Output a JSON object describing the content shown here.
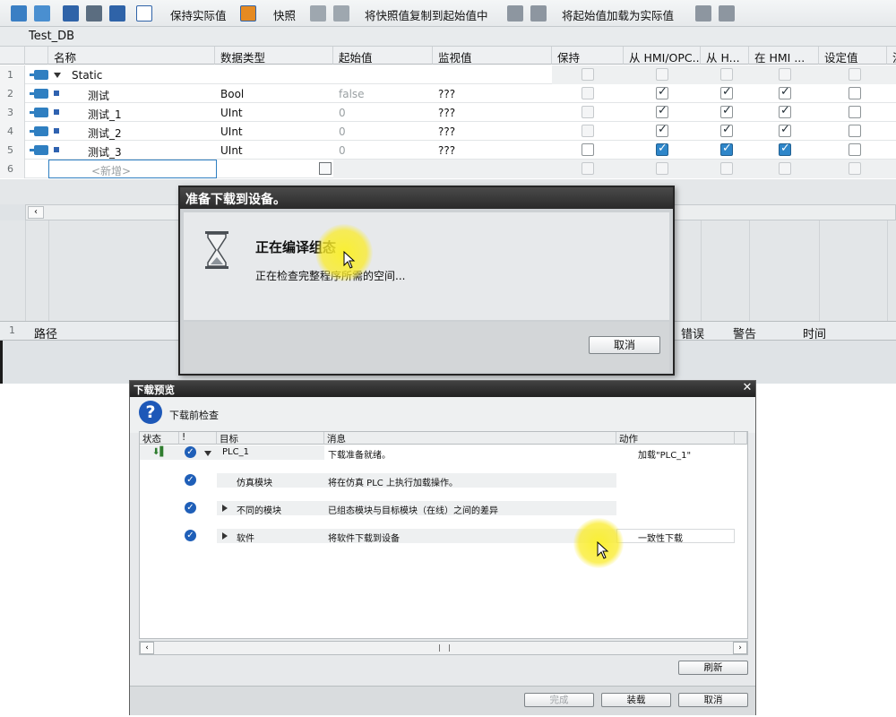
{
  "toolbar": {
    "keep_actual": "保持实际值",
    "snapshot": "快照",
    "copy_snapshot": "将快照值复制到起始值中",
    "load_start": "将起始值加载为实际值"
  },
  "db": {
    "title": "Test_DB"
  },
  "grid": {
    "headers": [
      "名称",
      "数据类型",
      "起始值",
      "监视值",
      "保持",
      "从 HMI/OPC...",
      "从 H...",
      "在 HMI ...",
      "设定值",
      "注"
    ],
    "rows": [
      {
        "num": "1",
        "name": "Static",
        "type": "",
        "start": "",
        "monitor": ""
      },
      {
        "num": "2",
        "name": "测试",
        "type": "Bool",
        "start": "false",
        "monitor": "???"
      },
      {
        "num": "3",
        "name": "测试_1",
        "type": "UInt",
        "start": "0",
        "monitor": "???"
      },
      {
        "num": "4",
        "name": "测试_2",
        "type": "UInt",
        "start": "0",
        "monitor": "???"
      },
      {
        "num": "5",
        "name": "测试_3",
        "type": "UInt",
        "start": "0",
        "monitor": "???"
      },
      {
        "num": "6",
        "name": "<新增>",
        "type": "",
        "start": "",
        "monitor": ""
      }
    ]
  },
  "info_bar": {
    "path": "路径",
    "error": "错误",
    "warning": "警告",
    "time": "时间",
    "row_num": "1"
  },
  "compile_dialog": {
    "title": "准备下载到设备。",
    "heading": "正在编译组态",
    "message": "正在检查完整程序所需的空间...",
    "cancel": "取消"
  },
  "download_dialog": {
    "title": "下载预览",
    "subtitle": "下载前检查",
    "headers": {
      "status": "状态",
      "info": "!",
      "target": "目标",
      "message": "消息",
      "action": "动作"
    },
    "rows": [
      {
        "target": "PLC_1",
        "message": "下载准备就绪。",
        "action": "加载\"PLC_1\""
      },
      {
        "target": "仿真模块",
        "message": "将在仿真 PLC 上执行加载操作。",
        "action": ""
      },
      {
        "target": "不同的模块",
        "message": "已组态模块与目标模块（在线）之间的差异",
        "action": ""
      },
      {
        "target": "软件",
        "message": "将软件下载到设备",
        "action": "一致性下载"
      }
    ],
    "refresh": "刷新",
    "finish": "完成",
    "load": "装载",
    "cancel": "取消"
  },
  "colors": {
    "accent_blue": "#2e86c9",
    "dialog_title": "#2a2a2a",
    "highlight": "#f5e61e"
  }
}
